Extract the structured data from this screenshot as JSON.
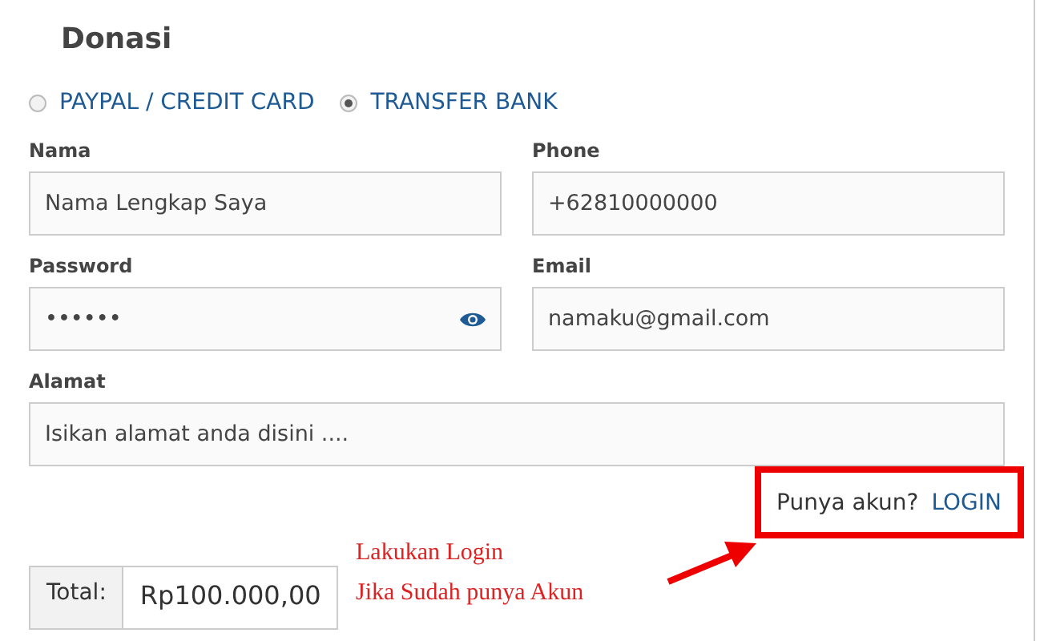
{
  "title": "Donasi",
  "payment_methods": [
    {
      "label": "PAYPAL / CREDIT CARD",
      "selected": false
    },
    {
      "label": "TRANSFER BANK",
      "selected": true
    }
  ],
  "fields": [
    {
      "label": "Nama",
      "value": "Nama Lengkap Saya",
      "kind": "text"
    },
    {
      "label": "Phone",
      "value": "+62810000000",
      "kind": "text"
    },
    {
      "label": "Password",
      "value": "••••••",
      "kind": "password"
    },
    {
      "label": "Email",
      "value": "namaku@gmail.com",
      "kind": "text"
    },
    {
      "label": "Alamat",
      "value": "Isikan alamat anda disini ....",
      "kind": "wide"
    }
  ],
  "login_prompt": {
    "question": "Punya akun?",
    "link": "LOGIN"
  },
  "annotation": [
    "Lakukan Login",
    "Jika Sudah punya Akun"
  ],
  "total": {
    "label": "Total:",
    "value": "Rp100.000,00"
  }
}
